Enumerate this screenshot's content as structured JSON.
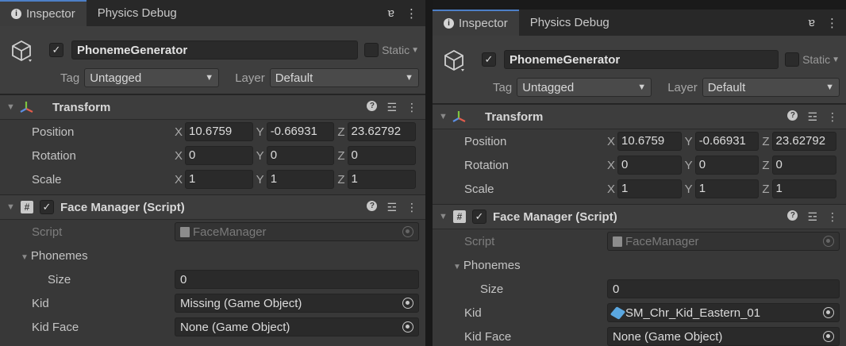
{
  "colors": {
    "panel_bg": "#383838",
    "tab_accent": "#4d7fc7",
    "object_icon": "#5aa7e0"
  },
  "inspectors": [
    {
      "tabs": {
        "inspector": "Inspector",
        "physics_debug": "Physics Debug"
      },
      "object": {
        "enabled_mark": "✓",
        "name": "PhonemeGenerator",
        "static_label": "Static",
        "tag_label": "Tag",
        "tag_value": "Untagged",
        "layer_label": "Layer",
        "layer_value": "Default"
      },
      "transform": {
        "title": "Transform",
        "position": {
          "label": "Position",
          "x": "10.6759",
          "y": "-0.66931",
          "z": "23.62792"
        },
        "rotation": {
          "label": "Rotation",
          "x": "0",
          "y": "0",
          "z": "0"
        },
        "scale": {
          "label": "Scale",
          "x": "1",
          "y": "1",
          "z": "1"
        }
      },
      "face_manager": {
        "title": "Face Manager (Script)",
        "enabled_mark": "✓",
        "script_label": "Script",
        "script_value": "FaceManager",
        "phonemes_label": "Phonemes",
        "size_label": "Size",
        "size_value": "0",
        "kid_label": "Kid",
        "kid_value": "Missing (Game Object)",
        "kid_face_label": "Kid Face",
        "kid_face_value": "None (Game Object)"
      }
    },
    {
      "tabs": {
        "inspector": "Inspector",
        "physics_debug": "Physics Debug"
      },
      "object": {
        "enabled_mark": "✓",
        "name": "PhonemeGenerator",
        "static_label": "Static",
        "tag_label": "Tag",
        "tag_value": "Untagged",
        "layer_label": "Layer",
        "layer_value": "Default"
      },
      "transform": {
        "title": "Transform",
        "position": {
          "label": "Position",
          "x": "10.6759",
          "y": "-0.66931",
          "z": "23.62792"
        },
        "rotation": {
          "label": "Rotation",
          "x": "0",
          "y": "0",
          "z": "0"
        },
        "scale": {
          "label": "Scale",
          "x": "1",
          "y": "1",
          "z": "1"
        }
      },
      "face_manager": {
        "title": "Face Manager (Script)",
        "enabled_mark": "✓",
        "script_label": "Script",
        "script_value": "FaceManager",
        "phonemes_label": "Phonemes",
        "size_label": "Size",
        "size_value": "0",
        "kid_label": "Kid",
        "kid_value": "SM_Chr_Kid_Eastern_01",
        "kid_face_label": "Kid Face",
        "kid_face_value": "None (Game Object)"
      }
    }
  ]
}
